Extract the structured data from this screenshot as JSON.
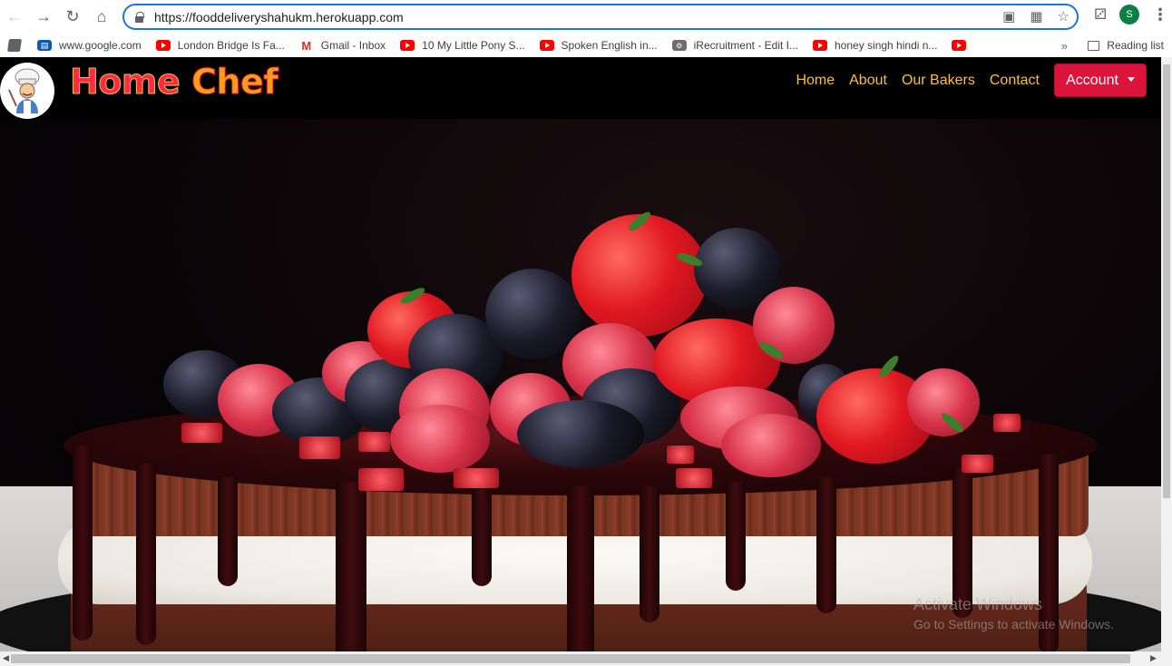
{
  "browser": {
    "url": "https://fooddeliveryshahukm.herokuapp.com",
    "profile_initial": "S",
    "bookmarks": [
      {
        "label": "www.google.com",
        "icon": "google-news-favicon"
      },
      {
        "label": "London Bridge Is Fa...",
        "icon": "youtube-favicon"
      },
      {
        "label": "Gmail - Inbox",
        "icon": "gmail-favicon"
      },
      {
        "label": "10 My Little Pony S...",
        "icon": "youtube-favicon"
      },
      {
        "label": "Spoken English in...",
        "icon": "youtube-favicon"
      },
      {
        "label": "iRecruitment - Edit I...",
        "icon": "irecruitment-favicon"
      },
      {
        "label": "honey singh hindi n...",
        "icon": "youtube-favicon"
      }
    ],
    "more_bookmarks": "»",
    "reading_list": "Reading list"
  },
  "site": {
    "brand_word1": "Home",
    "brand_word2": "Chef",
    "logo_icon": "chef-logo",
    "nav": [
      {
        "label": "Home"
      },
      {
        "label": "About"
      },
      {
        "label": "Our Bakers"
      },
      {
        "label": "Contact"
      }
    ],
    "account_label": "Account",
    "hero_image": "chocolate-cake-with-berries"
  },
  "os_watermark": {
    "title": "Activate Windows",
    "subtitle": "Go to Settings to activate Windows."
  },
  "colors": {
    "nav_link": "#f6c230",
    "account_button": "#dc143c",
    "brand_home": "#ff2a45",
    "brand_chef": "#ff9d1a"
  }
}
